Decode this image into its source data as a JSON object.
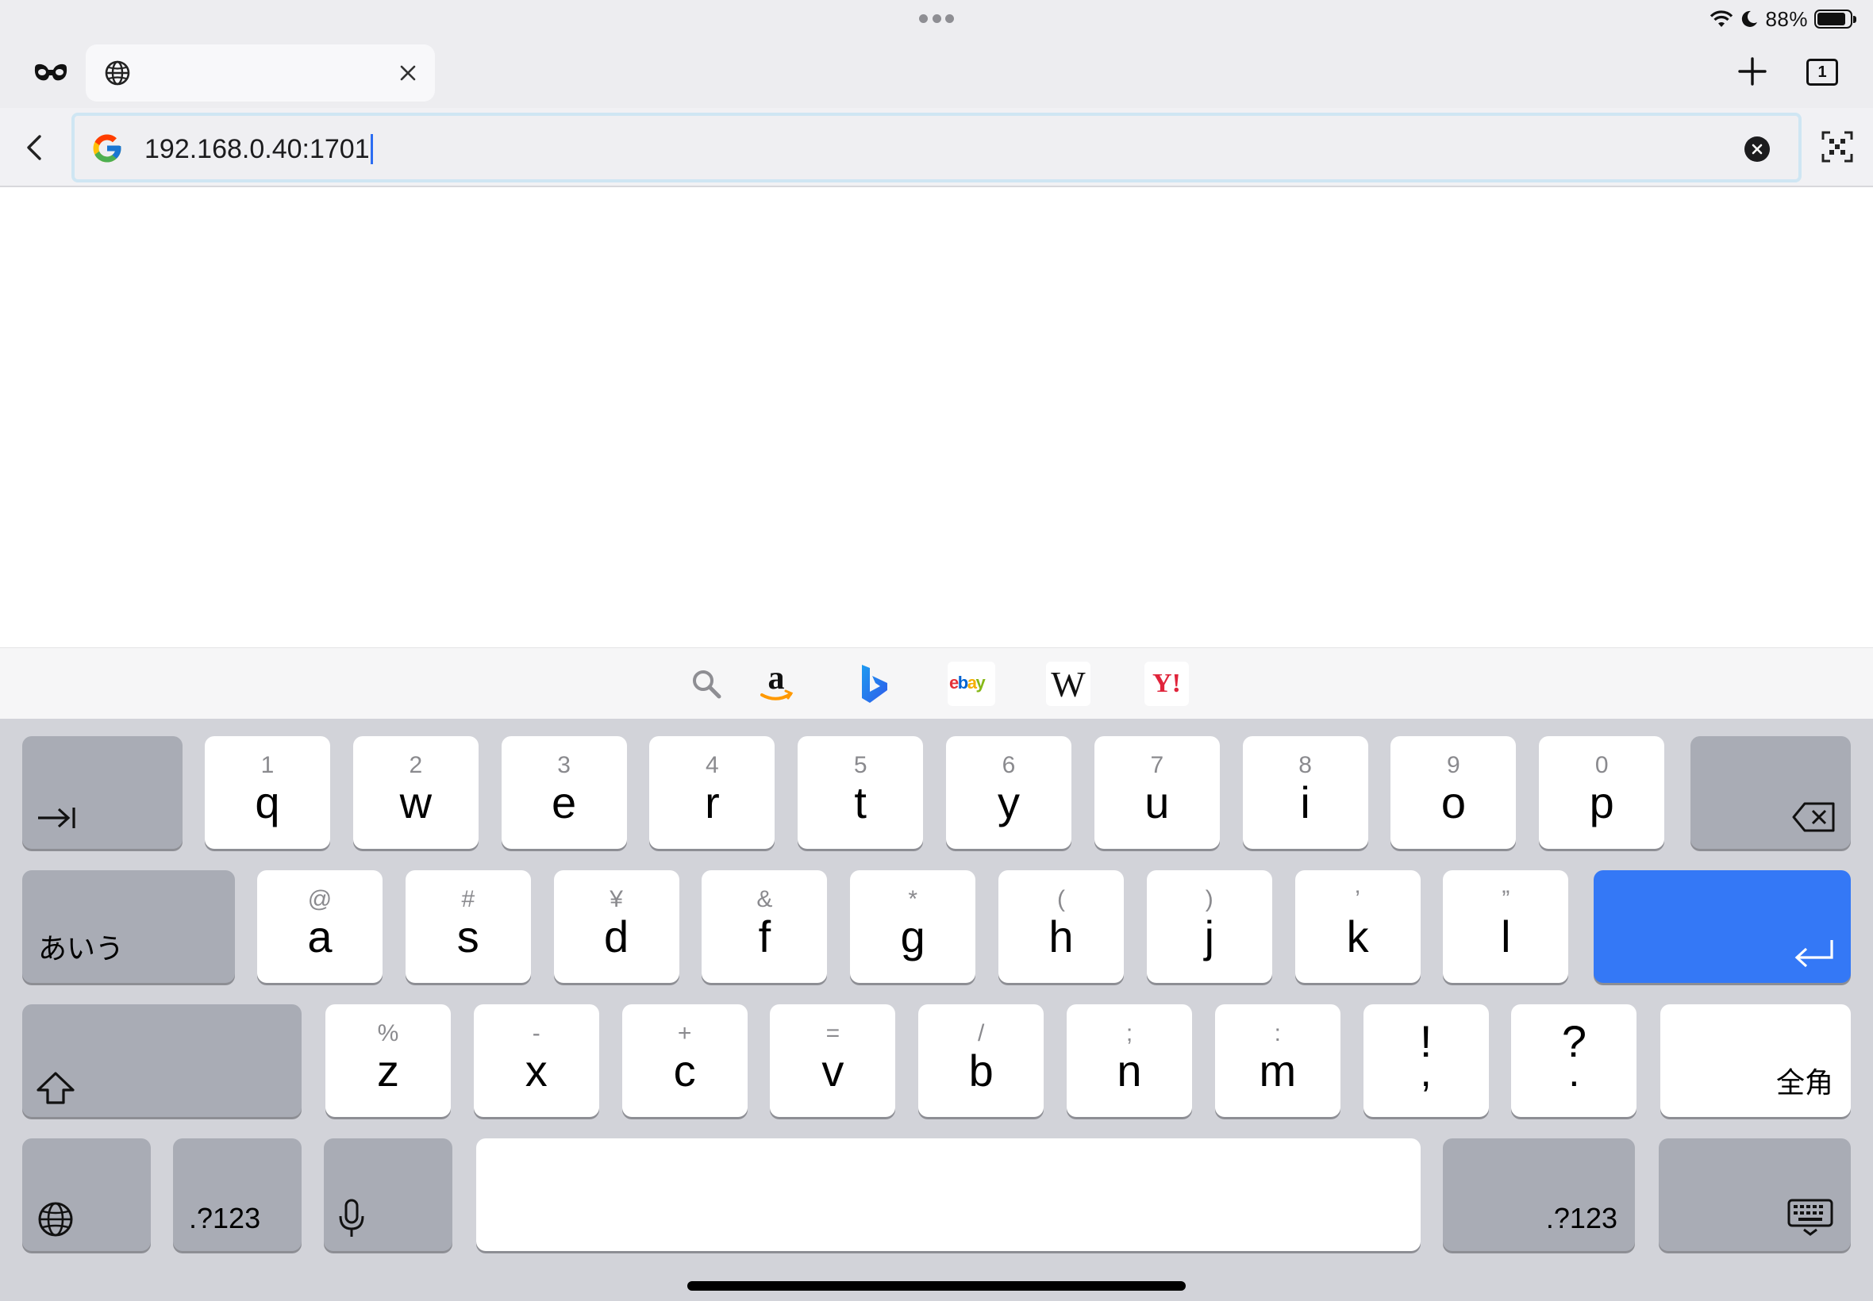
{
  "status_bar": {
    "battery_text": "88%",
    "battery_level": 0.88
  },
  "tab_bar": {
    "tab_count": "1"
  },
  "address_bar": {
    "url": "192.168.0.40:1701"
  },
  "search_engines": [
    "Amazon",
    "Bing",
    "eBay",
    "Wikipedia",
    "Yahoo!"
  ],
  "engine_labels": {
    "ebay": "ebay",
    "wikipedia": "W",
    "yahoo": "Y!"
  },
  "keyboard": {
    "row1": [
      {
        "alt": "1",
        "main": "q"
      },
      {
        "alt": "2",
        "main": "w"
      },
      {
        "alt": "3",
        "main": "e"
      },
      {
        "alt": "4",
        "main": "r"
      },
      {
        "alt": "5",
        "main": "t"
      },
      {
        "alt": "6",
        "main": "y"
      },
      {
        "alt": "7",
        "main": "u"
      },
      {
        "alt": "8",
        "main": "i"
      },
      {
        "alt": "9",
        "main": "o"
      },
      {
        "alt": "0",
        "main": "p"
      }
    ],
    "row2": [
      {
        "alt": "@",
        "main": "a"
      },
      {
        "alt": "#",
        "main": "s"
      },
      {
        "alt": "¥",
        "main": "d"
      },
      {
        "alt": "&",
        "main": "f"
      },
      {
        "alt": "*",
        "main": "g"
      },
      {
        "alt": "(",
        "main": "h"
      },
      {
        "alt": ")",
        "main": "j"
      },
      {
        "alt": "’",
        "main": "k"
      },
      {
        "alt": "”",
        "main": "l"
      }
    ],
    "row3": [
      {
        "alt": "%",
        "main": "z"
      },
      {
        "alt": "-",
        "main": "x"
      },
      {
        "alt": "+",
        "main": "c"
      },
      {
        "alt": "=",
        "main": "v"
      },
      {
        "alt": "/",
        "main": "b"
      },
      {
        "alt": ";",
        "main": "n"
      },
      {
        "alt": ":",
        "main": "m"
      },
      {
        "alt": "!",
        "main": ","
      },
      {
        "alt": "?",
        "main": "."
      }
    ],
    "kana_label": "あいう",
    "zenkaku_label": "全角",
    "numbers_label_left": ".?123",
    "numbers_label_right": ".?123"
  },
  "colors": {
    "return_key": "#3478f6",
    "keyboard_bg": "#d2d3d9",
    "chrome_bg": "#ededf0"
  }
}
